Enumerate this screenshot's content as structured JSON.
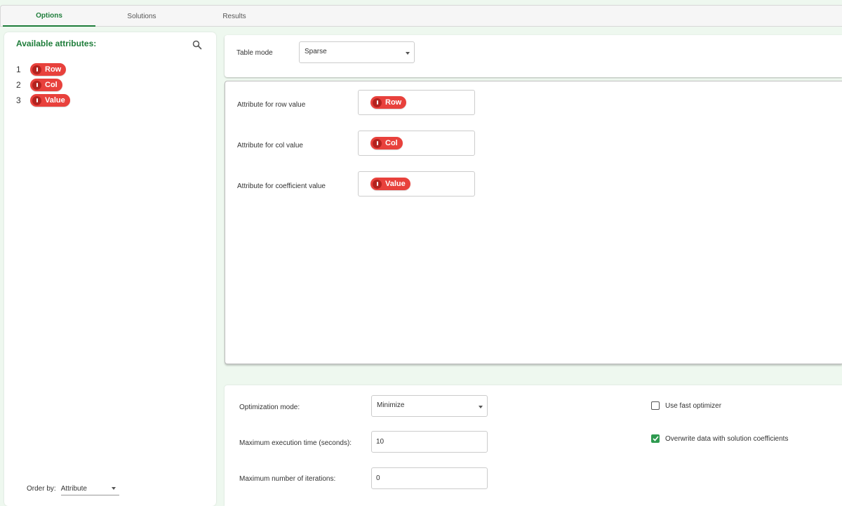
{
  "tabs": [
    {
      "label": "Options",
      "active": true
    },
    {
      "label": "Solutions",
      "active": false
    },
    {
      "label": "Results",
      "active": false
    }
  ],
  "left": {
    "title": "Available attributes:",
    "attributes": [
      {
        "index": "1",
        "name": "Row"
      },
      {
        "index": "2",
        "name": "Col"
      },
      {
        "index": "3",
        "name": "Value"
      }
    ],
    "order_by_label": "Order by:",
    "order_by_value": "Attribute"
  },
  "table_mode": {
    "label": "Table mode",
    "value": "Sparse"
  },
  "mapping": {
    "row_label": "Attribute for row value",
    "row_value": "Row",
    "col_label": "Attribute for col value",
    "col_value": "Col",
    "coef_label": "Attribute for coefficient value",
    "coef_value": "Value"
  },
  "options": {
    "opt_mode_label": "Optimization mode:",
    "opt_mode_value": "Minimize",
    "max_time_label": "Maximum execution time (seconds):",
    "max_time_value": "10",
    "max_iter_label": "Maximum number of iterations:",
    "max_iter_value": "0",
    "fast_optimizer_label": "Use fast optimizer",
    "fast_optimizer_checked": false,
    "overwrite_label": "Overwrite data with solution coefficients",
    "overwrite_checked": true
  },
  "colors": {
    "accent": "#1e7d3a",
    "pill": "#e8413c",
    "checkbox": "#2e9a4f"
  }
}
